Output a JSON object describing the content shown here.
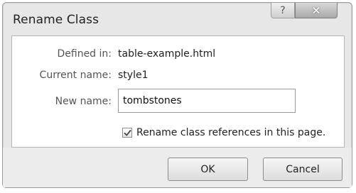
{
  "dialog": {
    "title": "Rename Class",
    "help_glyph": "?",
    "close_glyph": "✕"
  },
  "fields": {
    "defined_in_label": "Defined in:",
    "defined_in_value": "table-example.html",
    "current_name_label": "Current name:",
    "current_name_value": "style1",
    "new_name_label": "New name:",
    "new_name_value": "tombstones"
  },
  "checkbox": {
    "checked": true,
    "label": "Rename class references in this page."
  },
  "buttons": {
    "ok_label": "OK",
    "cancel_label": "Cancel"
  },
  "icons": {
    "help": "help-icon",
    "close": "close-icon",
    "check": "checkmark-icon"
  }
}
